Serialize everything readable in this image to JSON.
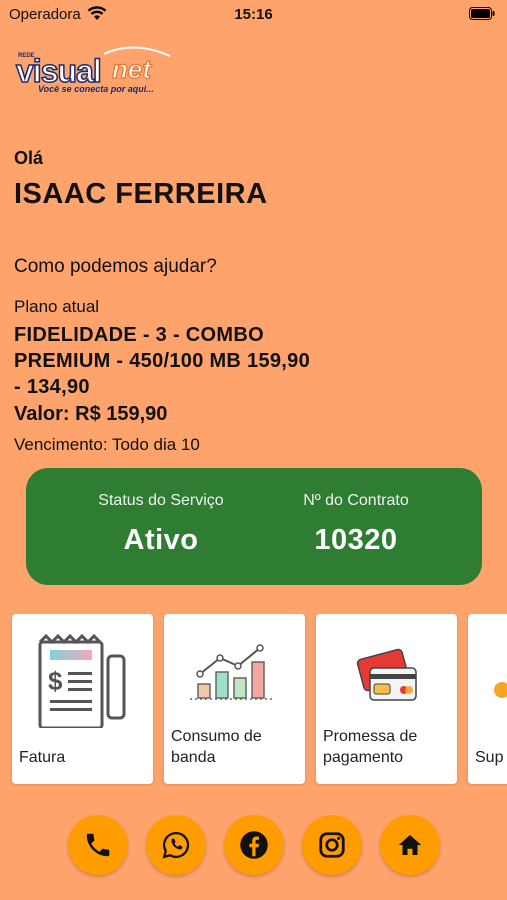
{
  "status_bar": {
    "carrier": "Operadora",
    "time": "15:16"
  },
  "logo": {
    "prefix": "REDE",
    "brand_a": "visual",
    "brand_b": "net",
    "tagline": "Você se conecta por aqui..."
  },
  "greeting": "Olá",
  "user_name": "ISAAC FERREIRA",
  "help_text": "Como podemos ajudar?",
  "plan": {
    "label": "Plano atual",
    "name": "FIDELIDADE - 3 - COMBO PREMIUM - 450/100 MB 159,90 - 134,90",
    "value": "Valor: R$ 159,90",
    "due": "Vencimento: Todo dia 10"
  },
  "status_card": {
    "status_label": "Status do Serviço",
    "status_value": "Ativo",
    "contract_label": "Nº do Contrato",
    "contract_value": "10320"
  },
  "tiles": [
    {
      "label": "Fatura",
      "icon": "invoice-icon"
    },
    {
      "label": "Consumo de banda",
      "icon": "bandwidth-chart-icon"
    },
    {
      "label": "Promessa de pagamento",
      "icon": "credit-card-icon"
    },
    {
      "label": "Sup",
      "icon": "support-icon"
    }
  ],
  "bottom_buttons": [
    "phone-icon",
    "whatsapp-icon",
    "facebook-icon",
    "instagram-icon",
    "home-icon"
  ],
  "colors": {
    "background": "#FFA36C",
    "status_card": "#2E7D33",
    "button": "#FF9D00"
  }
}
